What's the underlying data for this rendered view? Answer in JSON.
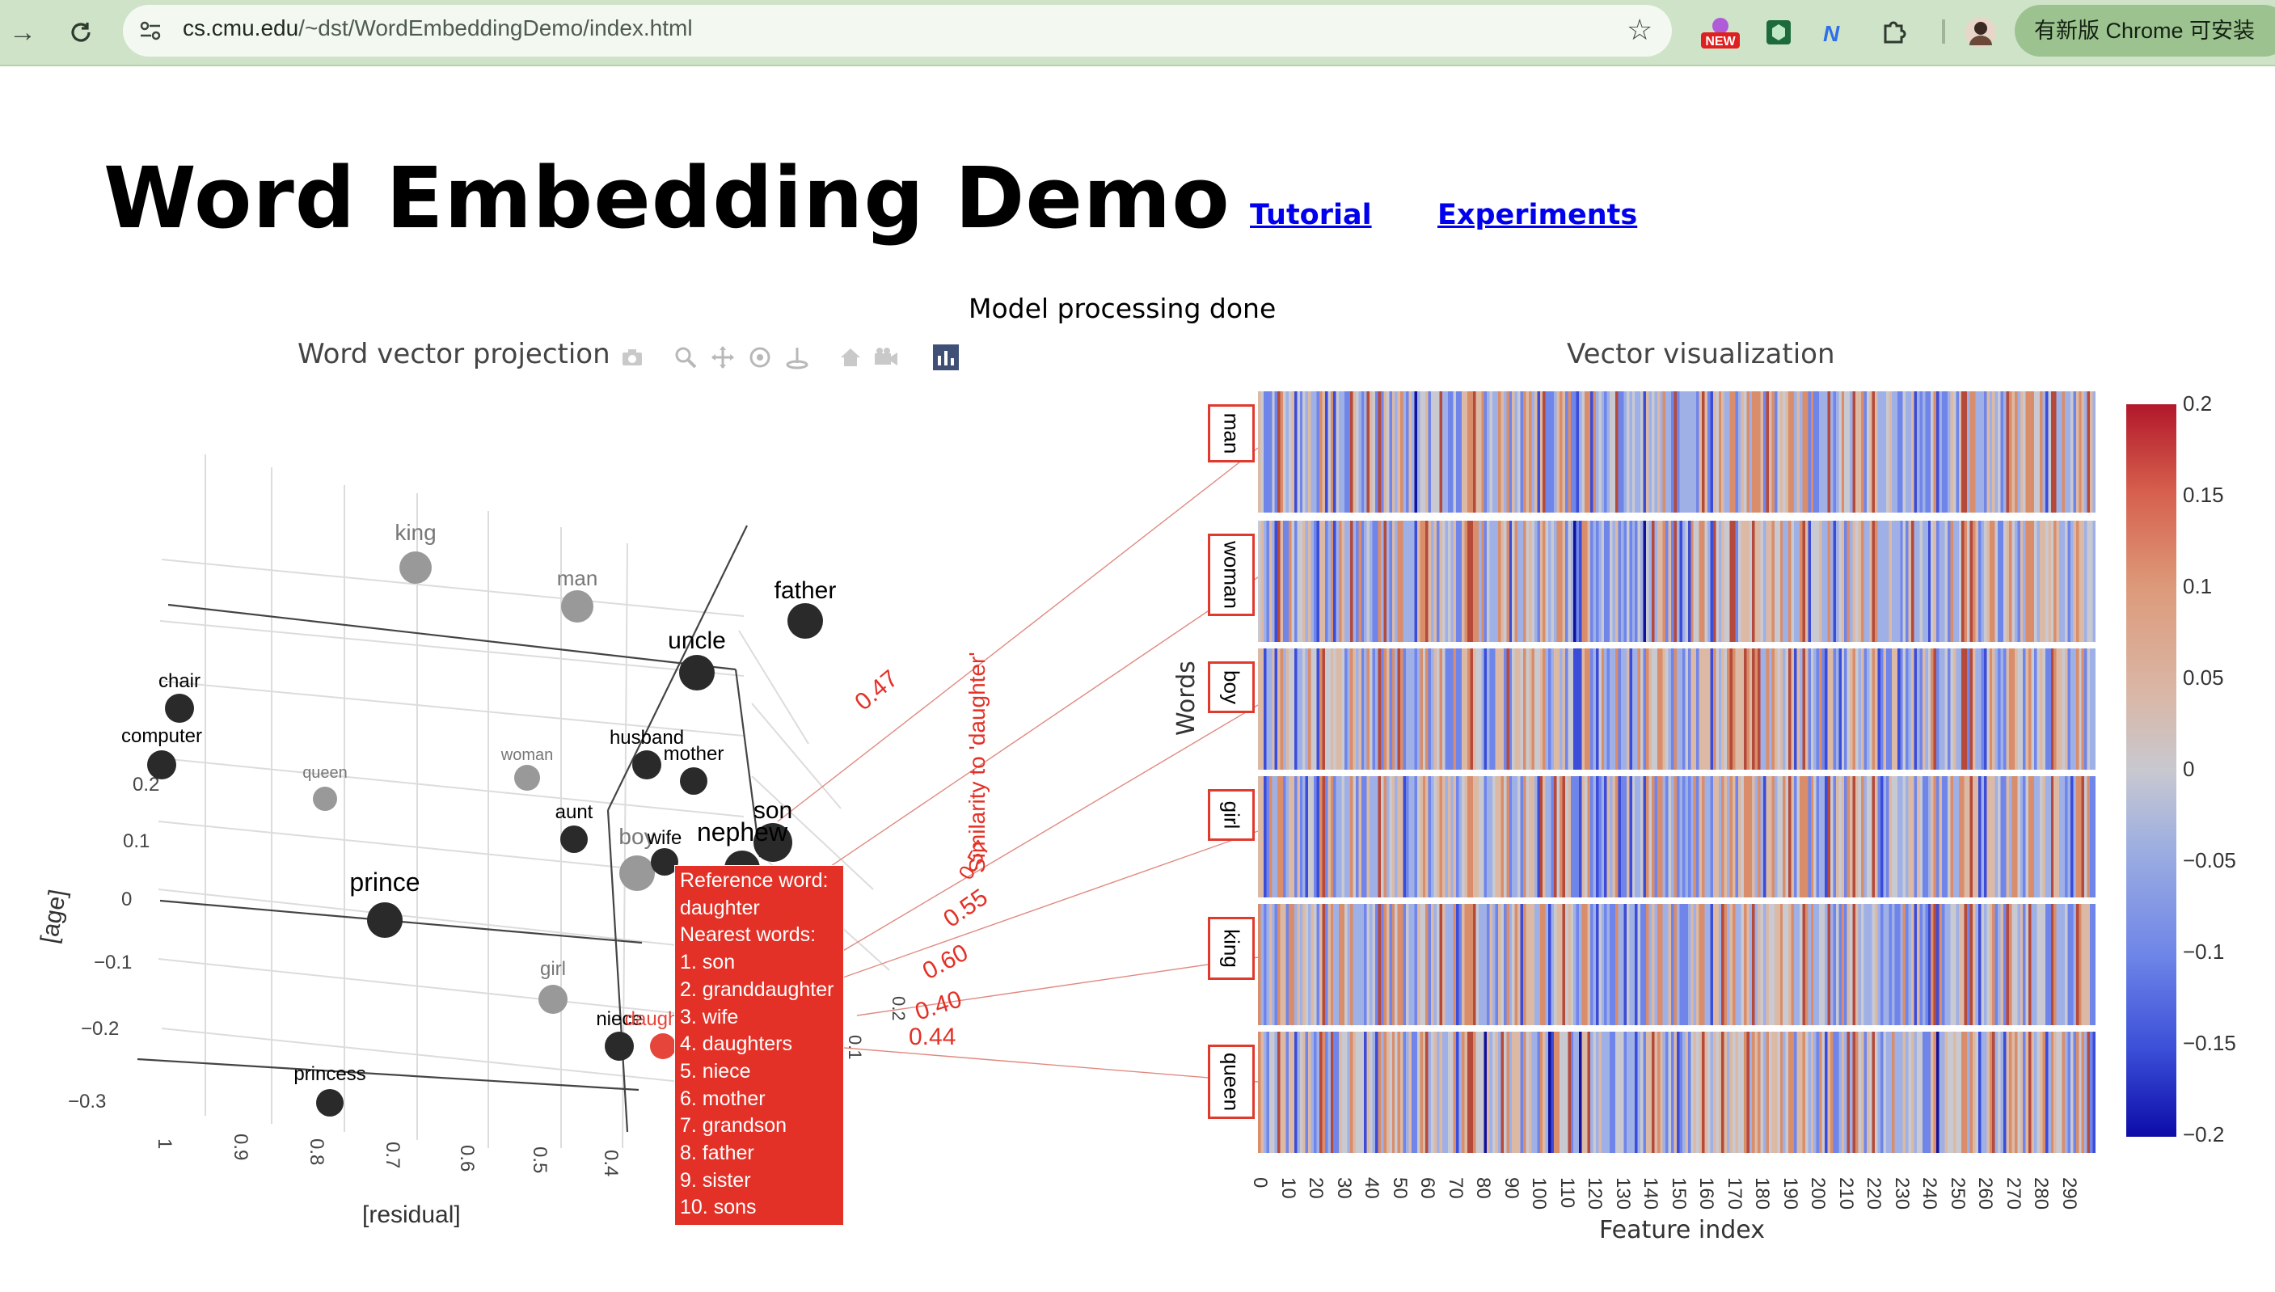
{
  "browser": {
    "url_host": "cs.cmu.edu",
    "url_path": "/~dst/WordEmbeddingDemo/index.html",
    "new_badge": "NEW",
    "update_text": "有新版 Chrome 可安装"
  },
  "header": {
    "title": "Word Embedding Demo",
    "tutorial_link": "Tutorial",
    "experiments_link": "Experiments"
  },
  "status": "Model processing done",
  "projection": {
    "title": "Word vector projection",
    "axis_age": "[age]",
    "axis_residual": "[residual]",
    "y_ticks": [
      "0.2",
      "0.1",
      "0",
      "−0.1",
      "−0.2",
      "−0.3"
    ],
    "x_ticks": [
      "1",
      "0.9",
      "0.8",
      "0.7",
      "0.6",
      "0.5",
      "0.4"
    ],
    "z_ticks": [
      "0.2",
      "0.1"
    ],
    "words": [
      {
        "label": "king",
        "tone": "gray"
      },
      {
        "label": "man",
        "tone": "gray"
      },
      {
        "label": "father",
        "tone": "dark"
      },
      {
        "label": "uncle",
        "tone": "dark"
      },
      {
        "label": "chair",
        "tone": "dark"
      },
      {
        "label": "computer",
        "tone": "dark"
      },
      {
        "label": "queen",
        "tone": "gray"
      },
      {
        "label": "woman",
        "tone": "gray"
      },
      {
        "label": "husband",
        "tone": "dark"
      },
      {
        "label": "mother",
        "tone": "dark"
      },
      {
        "label": "son",
        "tone": "dark"
      },
      {
        "label": "aunt",
        "tone": "dark"
      },
      {
        "label": "boy",
        "tone": "gray"
      },
      {
        "label": "wife",
        "tone": "dark"
      },
      {
        "label": "nephew",
        "tone": "dark"
      },
      {
        "label": "prince",
        "tone": "dark"
      },
      {
        "label": "girl",
        "tone": "gray"
      },
      {
        "label": "niece",
        "tone": "dark"
      },
      {
        "label": "daughter",
        "tone": "red"
      },
      {
        "label": "princess",
        "tone": "dark"
      }
    ],
    "similarity_title": "Similarity to 'daughter'",
    "similarities": [
      "0.47",
      "0.57",
      "0.55",
      "0.60",
      "0.40",
      "0.44"
    ]
  },
  "tooltip": {
    "lines": [
      "Reference word:",
      "daughter",
      "Nearest words:",
      "1. son",
      "2. granddaughter",
      "3. wife",
      "4. daughters",
      "5. niece",
      "6. mother",
      "7. grandson",
      "8. father",
      "9. sister",
      "10. sons"
    ]
  },
  "vector_viz": {
    "title": "Vector visualization",
    "ylabel": "Words",
    "xlabel": "Feature index",
    "words": [
      "man",
      "woman",
      "boy",
      "girl",
      "king",
      "queen"
    ],
    "x_ticks": [
      "0",
      "10",
      "20",
      "30",
      "40",
      "50",
      "60",
      "70",
      "80",
      "90",
      "100",
      "110",
      "120",
      "130",
      "140",
      "150",
      "160",
      "170",
      "180",
      "190",
      "200",
      "210",
      "220",
      "230",
      "240",
      "250",
      "260",
      "270",
      "280",
      "290"
    ],
    "colorbar_ticks": [
      "0.2",
      "0.15",
      "0.1",
      "0.05",
      "0",
      "−0.05",
      "−0.1",
      "−0.15",
      "−0.2"
    ]
  },
  "colors": {
    "highlight": "#e33127",
    "link": "#0000ee",
    "chrome_bg": "#cfe3c8"
  }
}
